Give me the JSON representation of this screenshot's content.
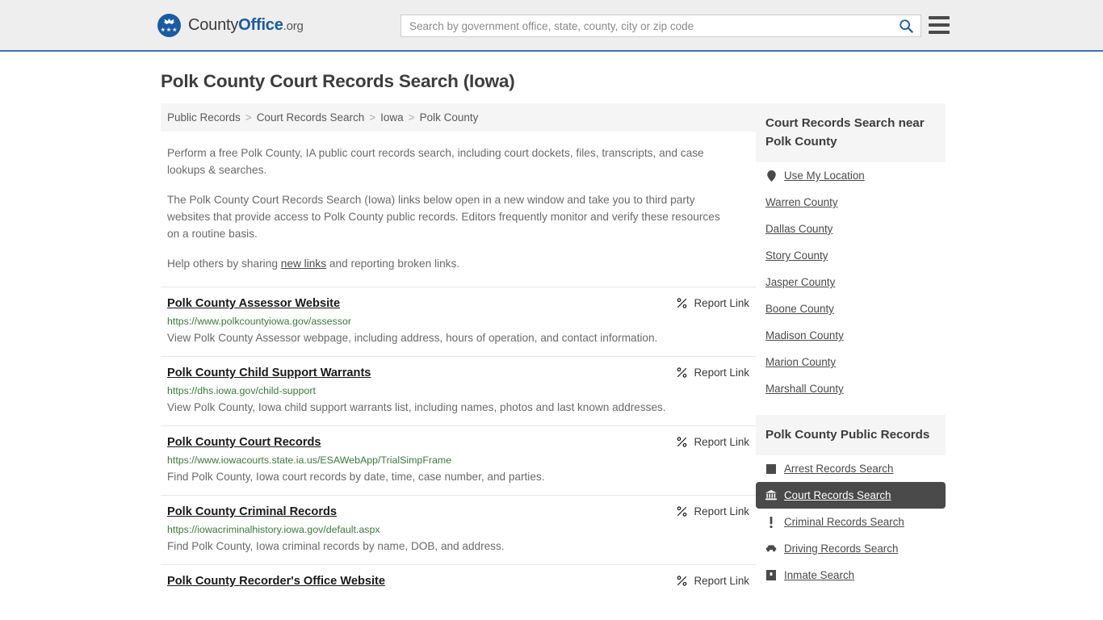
{
  "header": {
    "brand": {
      "part1": "County",
      "part2": "Office",
      "suffix": ".org",
      "logo_icon": "eagle-shield-logo",
      "stars": "★★★"
    },
    "search": {
      "placeholder": "Search by government office, state, county, city or zip code",
      "value": "",
      "icon": "search-icon"
    },
    "menu_icon": "hamburger-menu-icon"
  },
  "page": {
    "title": "Polk County Court Records Search (Iowa)"
  },
  "breadcrumb": {
    "separator": ">",
    "items": [
      {
        "label": "Public Records"
      },
      {
        "label": "Court Records Search"
      },
      {
        "label": "Iowa"
      },
      {
        "label": "Polk County"
      }
    ]
  },
  "intro": {
    "p1": "Perform a free Polk County, IA public court records search, including court dockets, files, transcripts, and case lookups & searches.",
    "p2": "The Polk County Court Records Search (Iowa) links below open in a new window and take you to third party websites that provide access to Polk County public records. Editors frequently monitor and verify these resources on a routine basis.",
    "p3_before": "Help others by sharing ",
    "p3_link": "new links",
    "p3_after": " and reporting broken links."
  },
  "results": {
    "report_label": "Report Link",
    "report_icon": "unlink-icon",
    "items": [
      {
        "title": "Polk County Assessor Website",
        "url": "https://www.polkcountyiowa.gov/assessor",
        "description": "View Polk County Assessor webpage, including address, hours of operation, and contact information."
      },
      {
        "title": "Polk County Child Support Warrants",
        "url": "https://dhs.iowa.gov/child-support",
        "description": "View Polk County, Iowa child support warrants list, including names, photos and last known addresses."
      },
      {
        "title": "Polk County Court Records",
        "url": "https://www.iowacourts.state.ia.us/ESAWebApp/TrialSimpFrame",
        "description": "Find Polk County, Iowa court records by date, time, case number, and parties."
      },
      {
        "title": "Polk County Criminal Records",
        "url": "https://iowacriminalhistory.iowa.gov/default.aspx",
        "description": "Find Polk County, Iowa criminal records by name, DOB, and address."
      },
      {
        "title": "Polk County Recorder's Office Website",
        "url": "",
        "description": ""
      }
    ]
  },
  "sidebar": {
    "nearby": {
      "title": "Court Records Search near Polk County",
      "items": [
        {
          "label": "Use My Location",
          "icon": "map-pin-icon"
        },
        {
          "label": "Warren County",
          "icon": ""
        },
        {
          "label": "Dallas County",
          "icon": ""
        },
        {
          "label": "Story County",
          "icon": ""
        },
        {
          "label": "Jasper County",
          "icon": ""
        },
        {
          "label": "Boone County",
          "icon": ""
        },
        {
          "label": "Madison County",
          "icon": ""
        },
        {
          "label": "Marion County",
          "icon": ""
        },
        {
          "label": "Marshall County",
          "icon": ""
        }
      ]
    },
    "public_records": {
      "title": "Polk County Public Records",
      "items": [
        {
          "label": "Arrest Records Search",
          "icon": "square-icon",
          "active": false
        },
        {
          "label": "Court Records Search",
          "icon": "courthouse-icon",
          "active": true
        },
        {
          "label": "Criminal Records Search",
          "icon": "exclamation-icon",
          "active": false
        },
        {
          "label": "Driving Records Search",
          "icon": "car-icon",
          "active": false
        },
        {
          "label": "Inmate Search",
          "icon": "jail-icon",
          "active": false
        }
      ]
    }
  },
  "colors": {
    "brand_blue": "#1b5ba0",
    "header_bg": "#eeeeee",
    "header_border": "#3f72a8",
    "url_green": "#3a7a3a",
    "active_bg": "#4a4a4a",
    "panel_bg": "#f5f5f5"
  }
}
